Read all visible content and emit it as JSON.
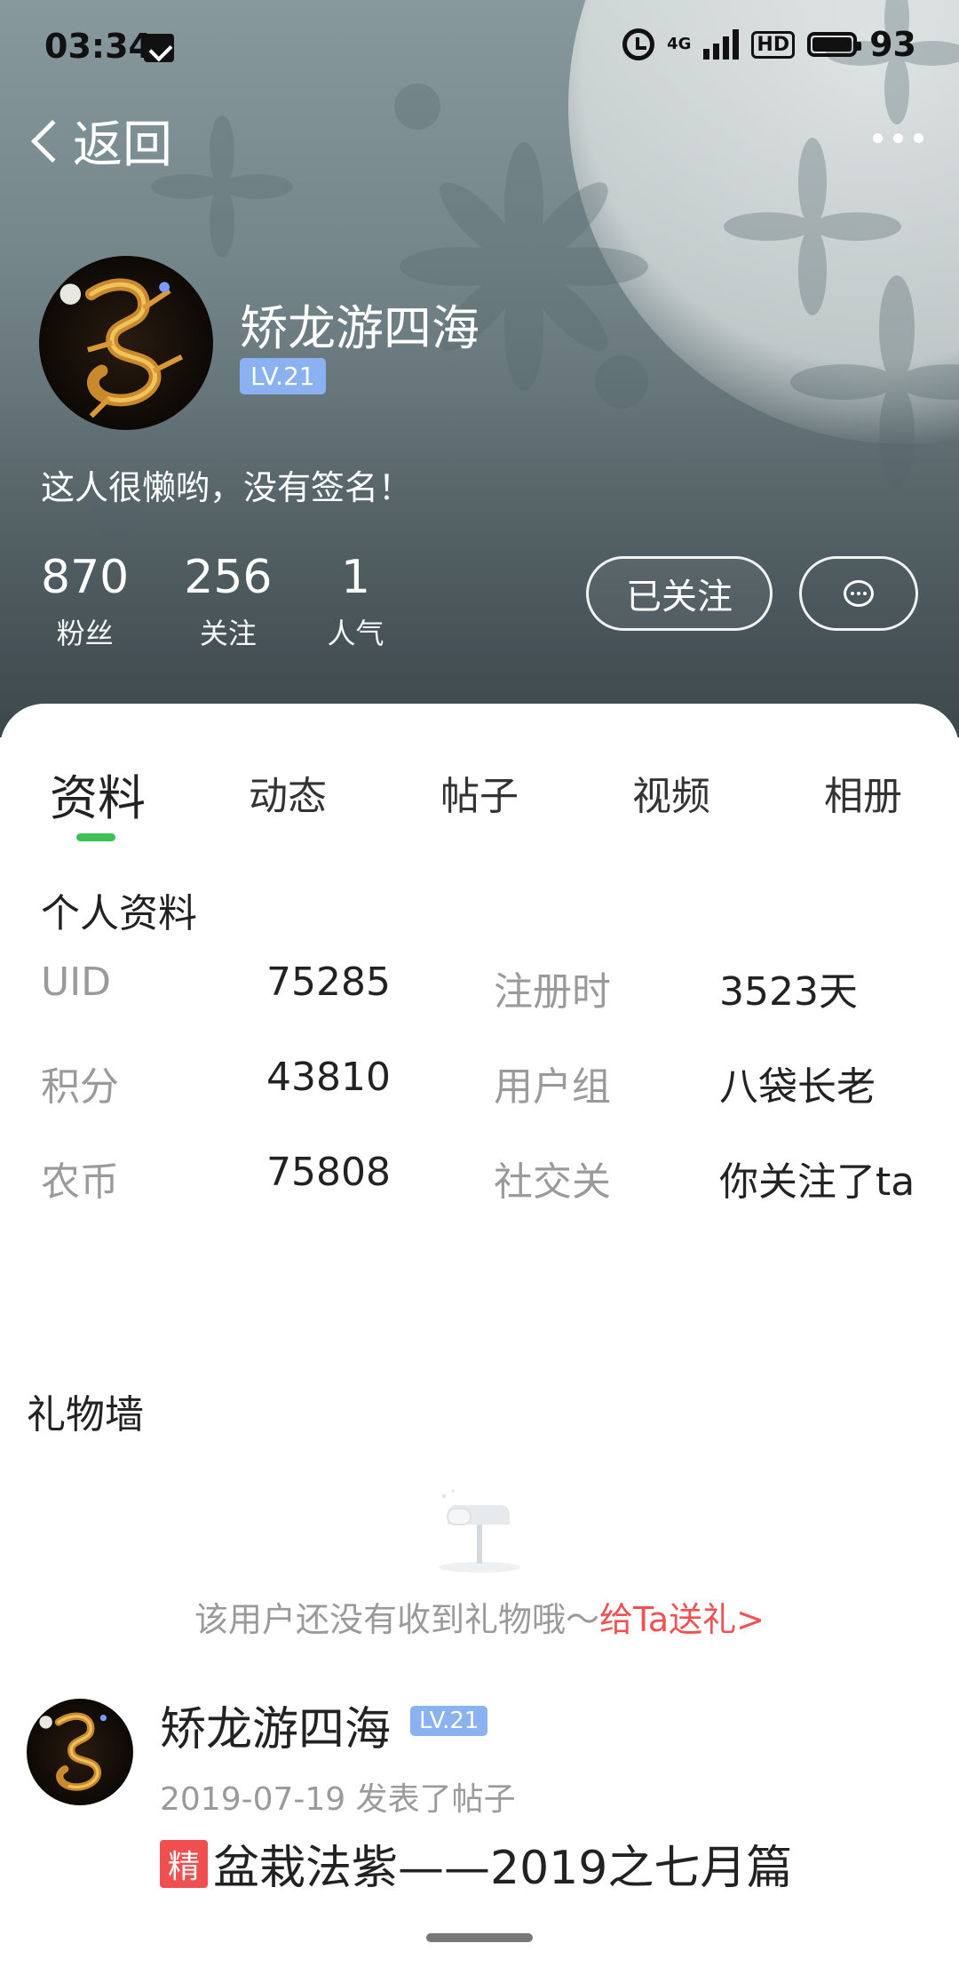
{
  "status_bar": {
    "time": "03:34",
    "network": "4G",
    "hd": "HD",
    "battery": "93"
  },
  "nav": {
    "back_label": "返回"
  },
  "profile": {
    "name": "矫龙游四海",
    "level": "LV.21",
    "signature": "这人很懒哟，没有签名！",
    "stats": [
      {
        "value": "870",
        "label": "粉丝"
      },
      {
        "value": "256",
        "label": "关注"
      },
      {
        "value": "1",
        "label": "人气"
      }
    ],
    "follow_button": "已关注",
    "message_icon": "chat-bubble-icon"
  },
  "tabs": [
    "资料",
    "动态",
    "帖子",
    "视频",
    "相册"
  ],
  "active_tab": "资料",
  "personal_info": {
    "title": "个人资料",
    "rows": [
      [
        {
          "k": "UID",
          "v": "75285"
        },
        {
          "k": "注册时",
          "v": "3523天"
        }
      ],
      [
        {
          "k": "积分",
          "v": "43810"
        },
        {
          "k": "用户组",
          "v": "八袋长老"
        }
      ],
      [
        {
          "k": "农币",
          "v": "75808"
        },
        {
          "k": "社交关",
          "v": "你关注了ta"
        }
      ]
    ]
  },
  "gift_wall": {
    "title": "礼物墙",
    "empty_text": "该用户还没有收到礼物哦～",
    "send_link": "给Ta送礼>"
  },
  "post": {
    "author": "矫龙游四海",
    "level": "LV.21",
    "meta": "2019-07-19 发表了帖子",
    "tag": "精",
    "title": "盆栽法紫——2019之七月篇"
  },
  "colors": {
    "accent_green": "#3fbf55",
    "level_badge": "#8ab1f0",
    "link_red": "#ef5252",
    "tag_red": "#ef4f4f"
  }
}
